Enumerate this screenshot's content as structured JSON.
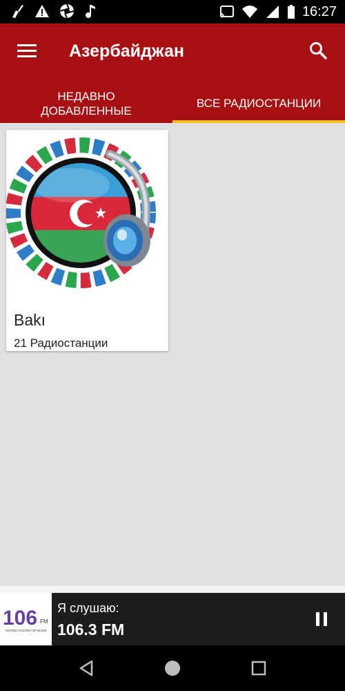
{
  "status_bar": {
    "time": "16:27",
    "icons": [
      "cleaner-icon",
      "warning-icon",
      "aperture-icon",
      "music-note-icon",
      "cast-icon",
      "wifi-icon",
      "signal-icon",
      "battery-icon"
    ]
  },
  "app_bar": {
    "title": "Азербайджан",
    "background": "#a80f12",
    "tabs": [
      {
        "label": "НЕДАВНО\nДОБАВЛЕННЫЕ",
        "active": false
      },
      {
        "label": "ВСЕ РАДИОСТАНЦИИ",
        "active": true
      }
    ],
    "indicator_color": "#f2c219"
  },
  "cards": [
    {
      "title": "Bakı",
      "subtitle": "21 Радиостанции",
      "image": "azerbaijan-flag-headphones-icon"
    }
  ],
  "player": {
    "label": "Я слушаю:",
    "station": "106.3 FM",
    "logo_text": "106",
    "logo_sub": "FM",
    "logo_caption": "UNITED COLORS OF MUSIC"
  },
  "nav": {
    "buttons": [
      "back-icon",
      "home-icon",
      "recents-icon"
    ]
  }
}
